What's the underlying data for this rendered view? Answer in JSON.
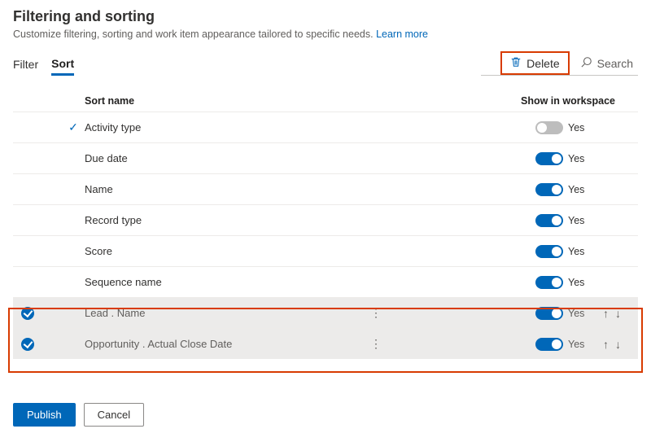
{
  "header": {
    "title": "Filtering and sorting",
    "subtitle_text": "Customize filtering, sorting and work item appearance tailored to specific needs. ",
    "learn_more": "Learn more"
  },
  "tabs": {
    "filter": "Filter",
    "sort": "Sort"
  },
  "toolbar": {
    "delete": "Delete",
    "search": "Search"
  },
  "table": {
    "header_name": "Sort name",
    "header_show": "Show in workspace"
  },
  "rows": [
    {
      "name": "Activity type",
      "yes": "Yes"
    },
    {
      "name": "Due date",
      "yes": "Yes"
    },
    {
      "name": "Name",
      "yes": "Yes"
    },
    {
      "name": "Record type",
      "yes": "Yes"
    },
    {
      "name": "Score",
      "yes": "Yes"
    },
    {
      "name": "Sequence name",
      "yes": "Yes"
    },
    {
      "name": "Lead . Name",
      "yes": "Yes"
    },
    {
      "name": "Opportunity . Actual Close Date",
      "yes": "Yes"
    }
  ],
  "footer": {
    "publish": "Publish",
    "cancel": "Cancel"
  }
}
